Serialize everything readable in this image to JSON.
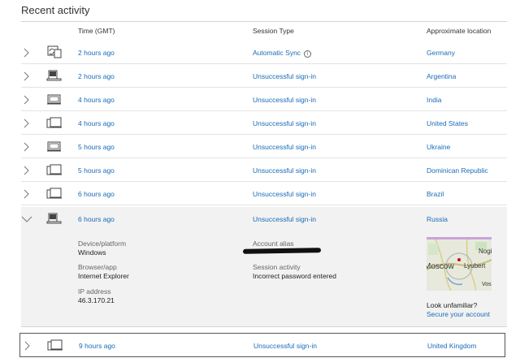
{
  "page": {
    "title": "Recent activity"
  },
  "columns": {
    "time": "Time (GMT)",
    "session_type": "Session Type",
    "location": "Approximate location"
  },
  "rows": [
    {
      "time": "2 hours ago",
      "session_type": "Automatic Sync",
      "location": "Germany",
      "device_icon": "sync-device-icon",
      "info_icon": "info-icon"
    },
    {
      "time": "2 hours ago",
      "session_type": "Unsuccessful sign-in",
      "location": "Argentina",
      "device_icon": "laptop-icon"
    },
    {
      "time": "4 hours ago",
      "session_type": "Unsuccessful sign-in",
      "location": "India",
      "device_icon": "tablet-icon"
    },
    {
      "time": "4 hours ago",
      "session_type": "Unsuccessful sign-in",
      "location": "United States",
      "device_icon": "multi-device-icon"
    },
    {
      "time": "5 hours ago",
      "session_type": "Unsuccessful sign-in",
      "location": "Ukraine",
      "device_icon": "tablet-icon"
    },
    {
      "time": "5 hours ago",
      "session_type": "Unsuccessful sign-in",
      "location": "Dominican Republic",
      "device_icon": "multi-device-icon"
    },
    {
      "time": "6 hours ago",
      "session_type": "Unsuccessful sign-in",
      "location": "Brazil",
      "device_icon": "multi-device-icon"
    },
    {
      "time": "6 hours ago",
      "session_type": "Unsuccessful sign-in",
      "location": "Russia",
      "device_icon": "laptop-icon",
      "expanded": true
    },
    {
      "time": "9 hours ago",
      "session_type": "Unsuccessful sign-in",
      "location": "United Kingdom",
      "device_icon": "multi-device-icon"
    }
  ],
  "details": {
    "device_label": "Device/platform",
    "device_value": "Windows",
    "browser_label": "Browser/app",
    "browser_value": "Internet Explorer",
    "ip_label": "IP address",
    "ip_value": "46.3.170.21",
    "alias_label": "Account alias",
    "session_label": "Session activity",
    "session_value": "Incorrect password entered",
    "map_labels": {
      "nogi": "Nogi",
      "moscow": "Moscow",
      "lyubert": "Lyubert",
      "vos": "Vos"
    },
    "look_unfamiliar": "Look unfamiliar?",
    "secure_link": "Secure your account"
  },
  "colors": {
    "link": "#1a6bb8",
    "expanded_bg": "#f2f2f2"
  }
}
